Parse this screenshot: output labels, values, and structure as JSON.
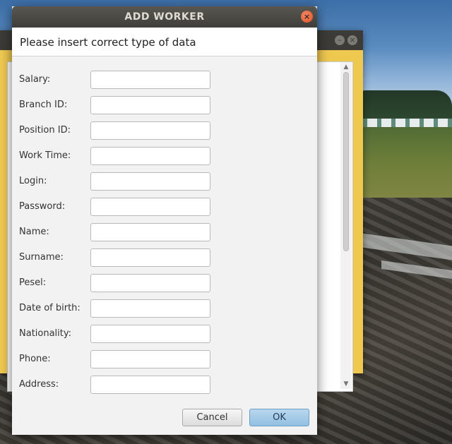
{
  "dialog": {
    "title": "ADD WORKER",
    "close_icon": "×",
    "header": "Please insert correct type of data"
  },
  "fields": [
    {
      "label": "Salary:",
      "value": ""
    },
    {
      "label": "Branch ID:",
      "value": ""
    },
    {
      "label": "Position ID:",
      "value": ""
    },
    {
      "label": "Work Time:",
      "value": ""
    },
    {
      "label": "Login:",
      "value": ""
    },
    {
      "label": "Password:",
      "value": ""
    },
    {
      "label": "Name:",
      "value": ""
    },
    {
      "label": "Surname:",
      "value": ""
    },
    {
      "label": "Pesel:",
      "value": ""
    },
    {
      "label": "Date of birth:",
      "value": ""
    },
    {
      "label": "Nationality:",
      "value": ""
    },
    {
      "label": "Phone:",
      "value": ""
    },
    {
      "label": "Address:",
      "value": ""
    }
  ],
  "buttons": {
    "cancel": "Cancel",
    "ok": "OK"
  },
  "parent_window": {
    "minimize_icon": "–",
    "close_icon": "×",
    "scroll_up_icon": "▲",
    "scroll_down_icon": "▼"
  },
  "colors": {
    "parent_frame": "#efc850",
    "close_button": "#e0501f",
    "ok_button": "#93c0e2"
  }
}
